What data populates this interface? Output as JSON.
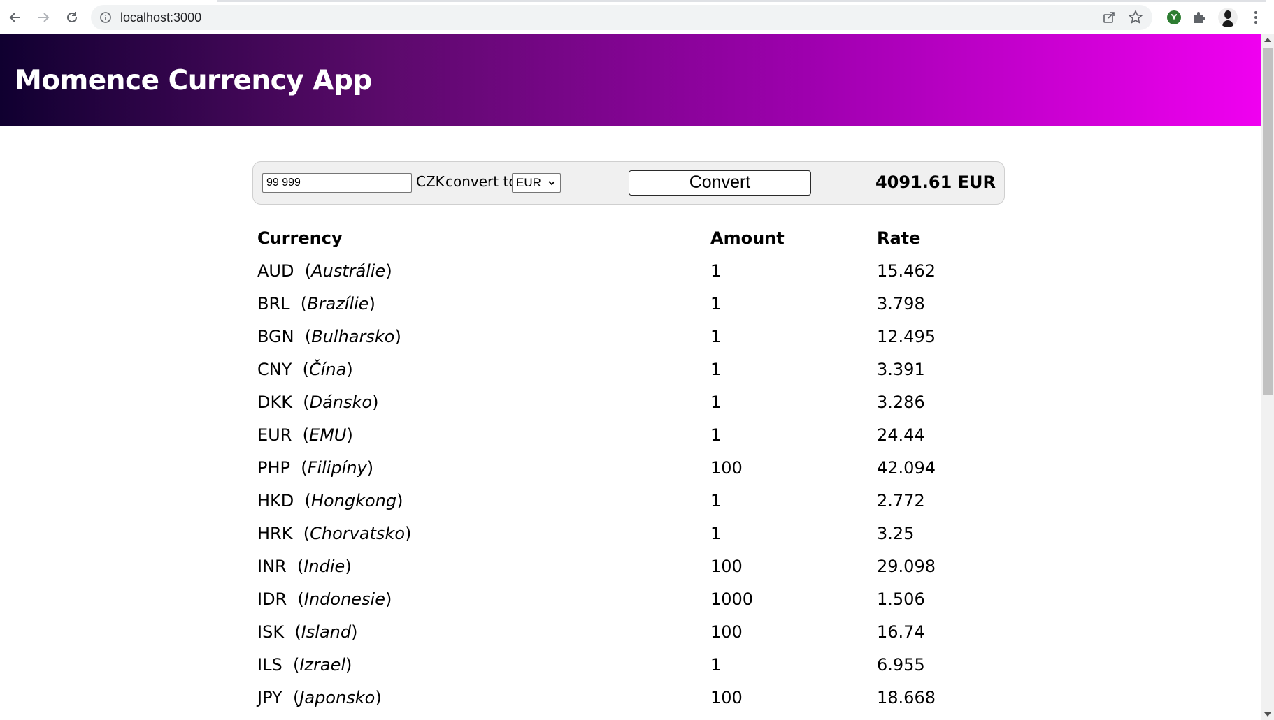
{
  "browser": {
    "url": "localhost:3000",
    "icons": [
      "back-arrow-icon",
      "forward-arrow-icon",
      "reload-icon",
      "info-icon",
      "share-icon",
      "star-icon",
      "extension-shield-icon",
      "puzzle-icon",
      "profile-avatar",
      "kebab-menu-icon"
    ]
  },
  "header": {
    "title": "Momence Currency App",
    "gradient_start": "#100030",
    "gradient_end": "#f000f0"
  },
  "converter": {
    "amount_value": "99 999",
    "from_currency": "CZK",
    "convert_to_label": "convert to",
    "to_currency": "EUR",
    "button_label": "Convert",
    "result": "4091.61 EUR"
  },
  "table": {
    "headers": {
      "currency": "Currency",
      "amount": "Amount",
      "rate": "Rate"
    },
    "rows": [
      {
        "code": "AUD",
        "name": "Austrálie",
        "amount": "1",
        "rate": "15.462"
      },
      {
        "code": "BRL",
        "name": "Brazílie",
        "amount": "1",
        "rate": "3.798"
      },
      {
        "code": "BGN",
        "name": "Bulharsko",
        "amount": "1",
        "rate": "12.495"
      },
      {
        "code": "CNY",
        "name": "Čína",
        "amount": "1",
        "rate": "3.391"
      },
      {
        "code": "DKK",
        "name": "Dánsko",
        "amount": "1",
        "rate": "3.286"
      },
      {
        "code": "EUR",
        "name": "EMU",
        "amount": "1",
        "rate": "24.44"
      },
      {
        "code": "PHP",
        "name": "Filipíny",
        "amount": "100",
        "rate": "42.094"
      },
      {
        "code": "HKD",
        "name": "Hongkong",
        "amount": "1",
        "rate": "2.772"
      },
      {
        "code": "HRK",
        "name": "Chorvatsko",
        "amount": "1",
        "rate": "3.25"
      },
      {
        "code": "INR",
        "name": "Indie",
        "amount": "100",
        "rate": "29.098"
      },
      {
        "code": "IDR",
        "name": "Indonesie",
        "amount": "1000",
        "rate": "1.506"
      },
      {
        "code": "ISK",
        "name": "Island",
        "amount": "100",
        "rate": "16.74"
      },
      {
        "code": "ILS",
        "name": "Izrael",
        "amount": "1",
        "rate": "6.955"
      },
      {
        "code": "JPY",
        "name": "Japonsko",
        "amount": "100",
        "rate": "18.668"
      }
    ]
  }
}
